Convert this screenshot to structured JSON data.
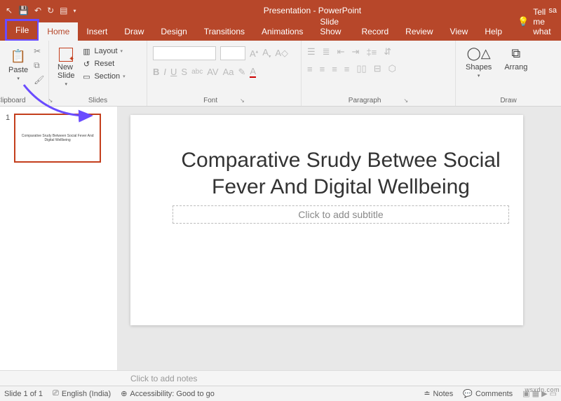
{
  "titlebar": {
    "title": "Presentation - PowerPoint",
    "user_fragment": "sa"
  },
  "tabs": {
    "file": "File",
    "home": "Home",
    "insert": "Insert",
    "draw": "Draw",
    "design": "Design",
    "transitions": "Transitions",
    "animations": "Animations",
    "slideshow": "Slide Show",
    "record": "Record",
    "review": "Review",
    "view": "View",
    "help": "Help",
    "tellme": "Tell me what"
  },
  "ribbon": {
    "clipboard": {
      "paste": "Paste",
      "label": "Clipboard"
    },
    "slides": {
      "newslide": "New\nSlide",
      "layout": "Layout",
      "reset": "Reset",
      "section": "Section",
      "label": "Slides"
    },
    "font": {
      "label": "Font"
    },
    "paragraph": {
      "label": "Paragraph"
    },
    "drawing": {
      "shapes": "Shapes",
      "arrange": "Arrang",
      "label": "Draw"
    }
  },
  "thumb": {
    "num": "1",
    "text": "Comparative Srudy Between Social Fever And Digital Wellbeing"
  },
  "slide": {
    "title": "Comparative Srudy Betwee Social Fever And Digital Wellbeing",
    "subtitle_placeholder": "Click to add subtitle"
  },
  "notes": {
    "placeholder": "Click to add notes"
  },
  "status": {
    "slide": "Slide 1 of 1",
    "lang": "English (India)",
    "access": "Accessibility: Good to go",
    "notes": "Notes",
    "comments": "Comments"
  },
  "watermark": "wsxdn.com"
}
